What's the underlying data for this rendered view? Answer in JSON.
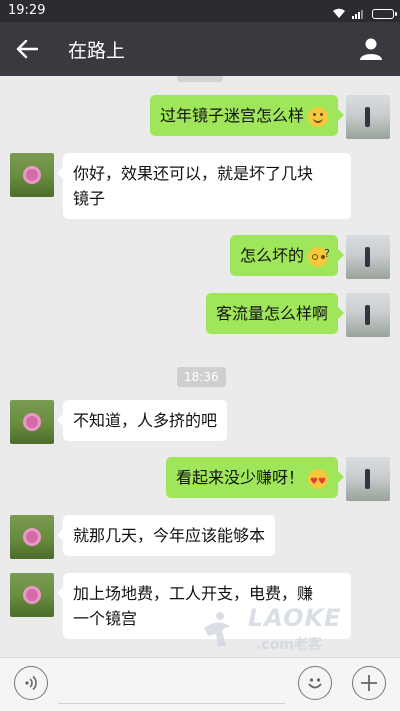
{
  "status_bar": {
    "time": "19:29",
    "icons": [
      "wifi-icon",
      "signal-icon",
      "battery-icon"
    ]
  },
  "header": {
    "title": "在路上",
    "back_icon": "back-arrow-icon",
    "profile_icon": "profile-icon"
  },
  "messages": [
    {
      "side": "right",
      "text": "过年镜子迷宫怎么样",
      "emoji": "smile-emoji"
    },
    {
      "side": "left",
      "line1": "你好，效果还可以，就是坏了几块",
      "line2": "镜子"
    },
    {
      "side": "right",
      "text": "怎么坏的",
      "emoji": "dizzy-emoji"
    },
    {
      "side": "right",
      "text": "客流量怎么样啊"
    },
    {
      "side": "left",
      "text": "不知道，人多挤的吧"
    },
    {
      "side": "right",
      "text": "看起来没少赚呀！",
      "emoji": "heart-eyes-emoji"
    },
    {
      "side": "left",
      "text": "就那几天，今年应该能够本"
    },
    {
      "side": "left",
      "line1": "加上场地费，工人开支，电费，赚",
      "line2": "一个镜宫"
    }
  ],
  "timestamp": "18:36",
  "watermark": {
    "brand": "LAOKE",
    "sub": ".com老客"
  },
  "input_bar": {
    "voice_icon": "voice-icon",
    "emoji_icon": "emoji-icon",
    "plus_icon": "plus-icon"
  },
  "colors": {
    "title_bar": "#393a3f",
    "status_bar": "#2b2c30",
    "chat_bg": "#ebebeb",
    "bubble_sent": "#9fe65a",
    "bubble_received": "#ffffff"
  }
}
